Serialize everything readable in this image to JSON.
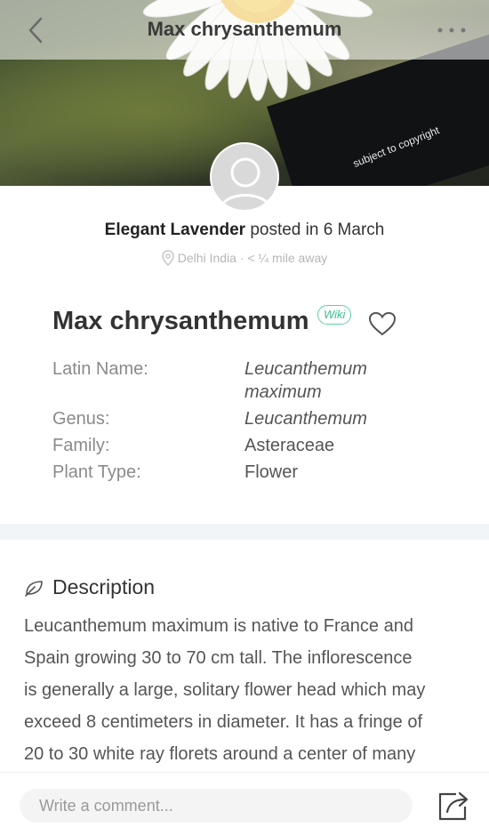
{
  "header": {
    "title": "Max chrysanthemum",
    "back_icon": "chevron-left-icon",
    "more_icon": "more-dots-icon"
  },
  "hero": {
    "overlay_text": "subject to copyright"
  },
  "post": {
    "author": "Elegant Lavender",
    "action": "posted in 6 March",
    "location": "Delhi India · < ¼ mile away"
  },
  "plant": {
    "name": "Max chrysanthemum",
    "badge": "Wiki",
    "favorite_icon": "heart-icon",
    "info": [
      {
        "label": "Latin Name:",
        "value_line1": "Leucanthemum",
        "value_line2": "maximum"
      },
      {
        "label": "Genus:",
        "value": "Leucanthemum"
      },
      {
        "label": "Family:",
        "value": "Asteraceae"
      },
      {
        "label": "Plant Type:",
        "value": "Flower"
      }
    ]
  },
  "description": {
    "title": "Description",
    "lines": [
      "Leucanthemum maximum is native to France and",
      "Spain growing 30 to 70 cm tall. The inflorescence",
      "is generally a large, solitary flower head which may",
      "exceed 8 centimeters in diameter. It has a fringe of",
      "20 to 30 white ray florets around a center of many"
    ]
  },
  "bottom": {
    "comment_placeholder": "Write a comment...",
    "share_icon": "share-icon"
  },
  "colors": {
    "accent_green": "#3fbf8e",
    "divider": "#f2f5f8"
  }
}
